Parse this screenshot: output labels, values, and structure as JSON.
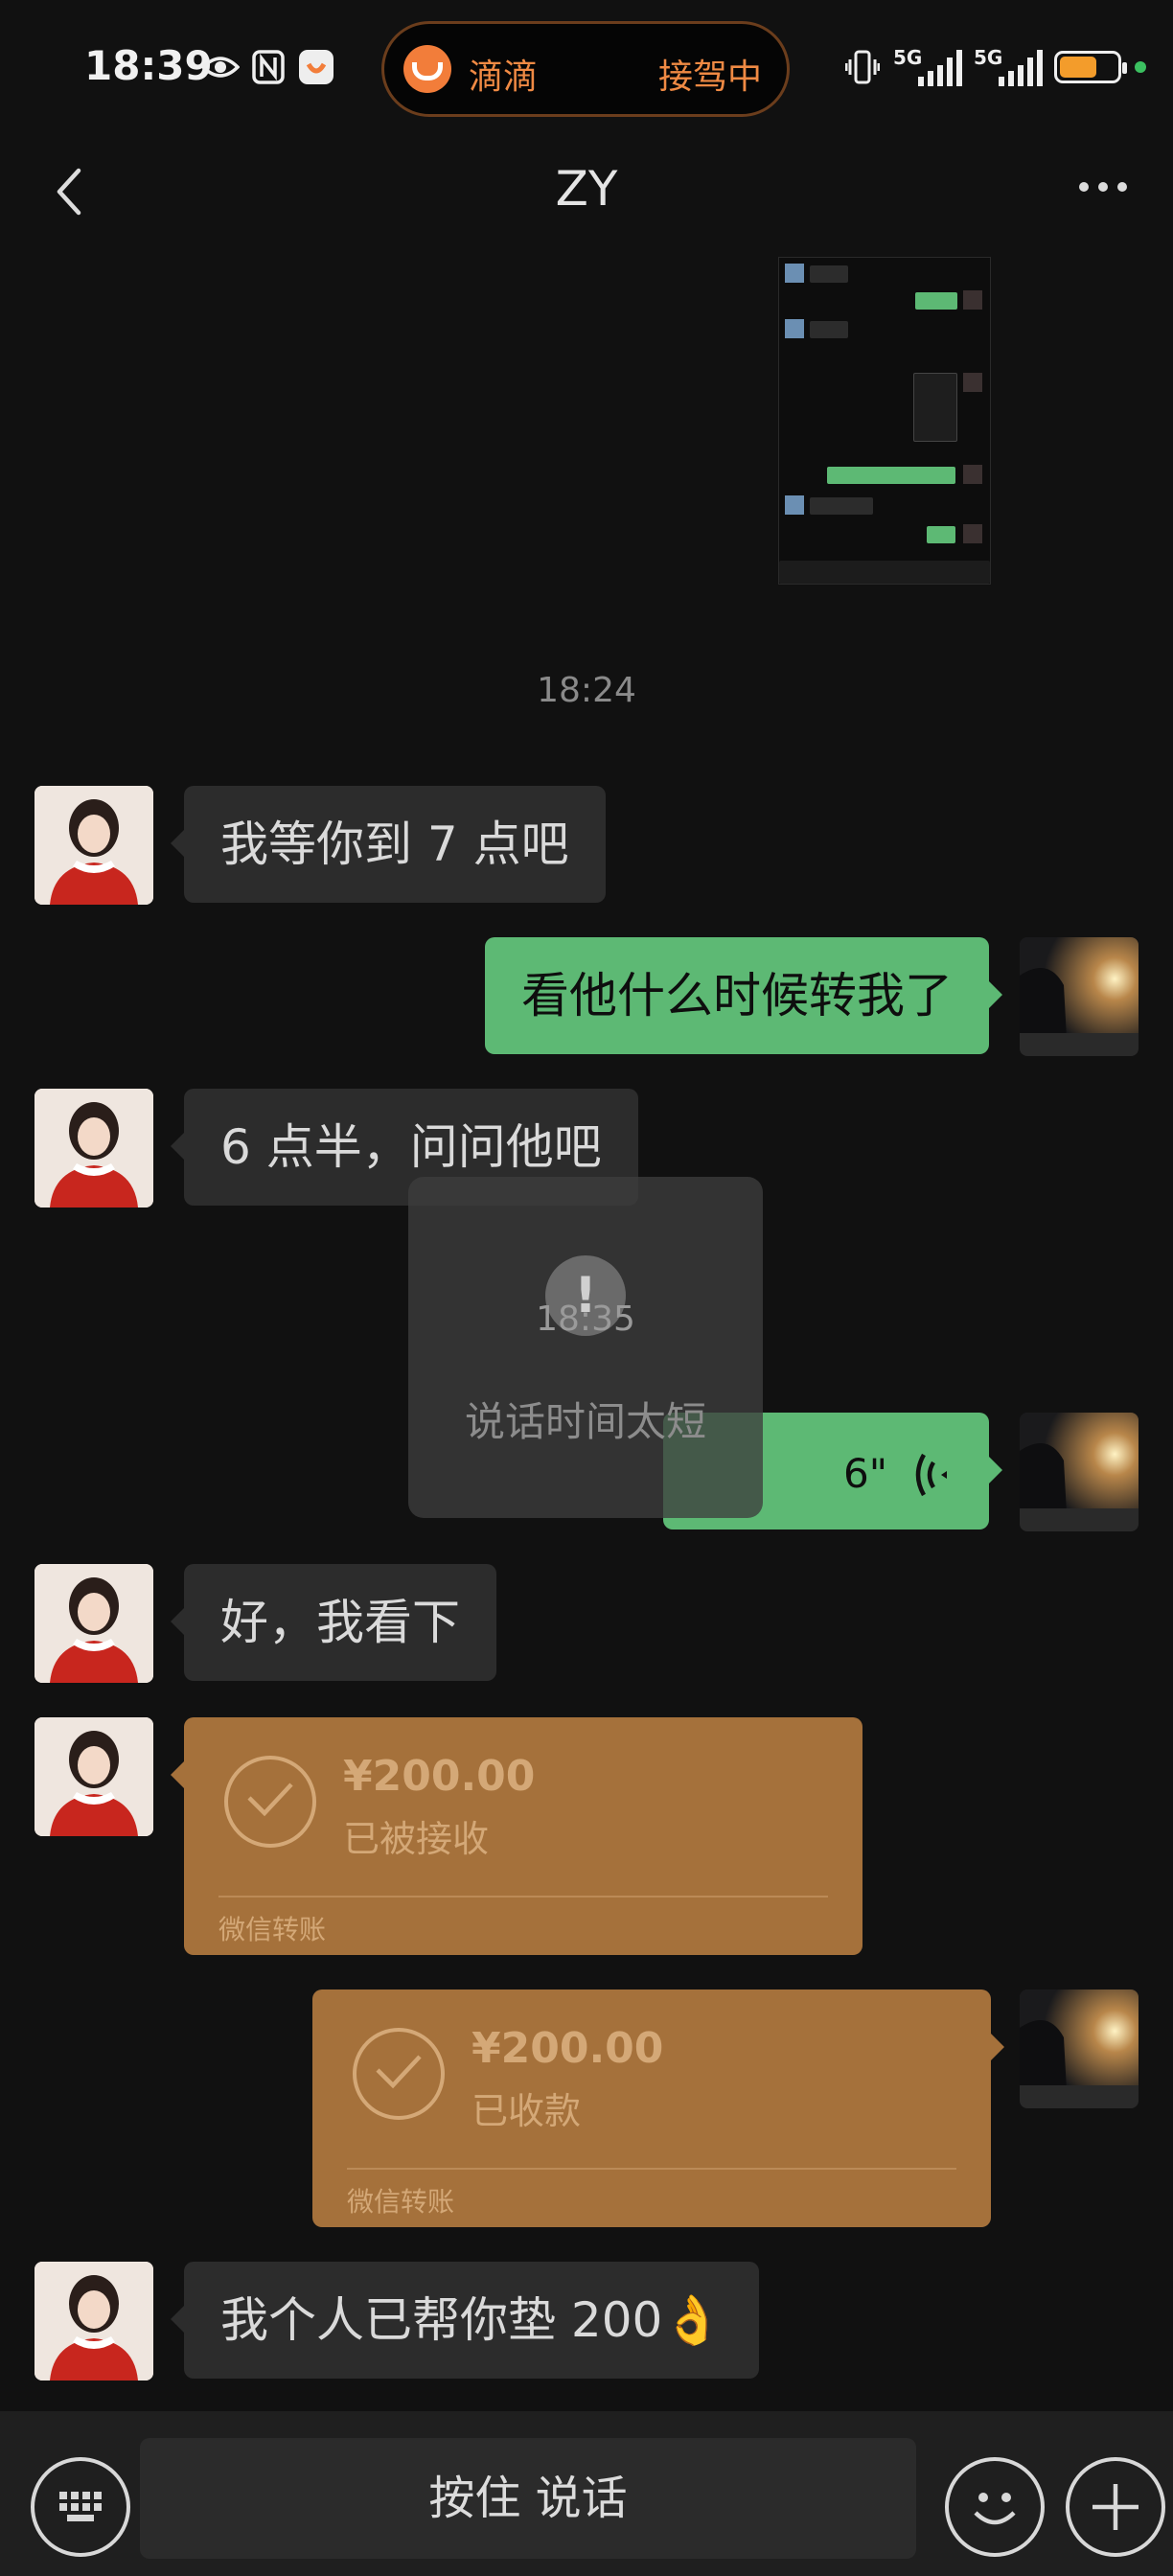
{
  "status_bar": {
    "time": "18:39",
    "left_icons": [
      "eye-icon",
      "nfc-icon",
      "didi-notification-icon"
    ],
    "live_activity": {
      "app": "滴滴",
      "status": "接驾中"
    },
    "network_1": "5G",
    "network_2": "5G",
    "battery_level": 0.65
  },
  "header": {
    "title": "ZY"
  },
  "shared_screenshot": {
    "rows": [
      "",
      "",
      "",
      "",
      "",
      "",
      "",
      ""
    ]
  },
  "timestamps": {
    "t1": "18:24",
    "t2": "18:35"
  },
  "messages": [
    {
      "from": "them",
      "text": "我等你到 7 点吧"
    },
    {
      "from": "me",
      "text": "看他什么时候转我了"
    },
    {
      "from": "them",
      "text": "6 点半，问问他吧"
    },
    {
      "from": "me",
      "voice_duration": "6\""
    },
    {
      "from": "them",
      "text": "好，我看下"
    },
    {
      "from": "them",
      "transfer": {
        "amount": "¥200.00",
        "status": "已被接收",
        "label": "微信转账"
      }
    },
    {
      "from": "me",
      "transfer": {
        "amount": "¥200.00",
        "status": "已收款",
        "label": "微信转账"
      }
    },
    {
      "from": "them",
      "text": "我个人已帮你垫 200👌"
    }
  ],
  "toast": {
    "text": "说话时间太短",
    "icon": "!"
  },
  "input_bar": {
    "hold_to_talk": "按住 说话"
  },
  "colors": {
    "outgoing_bubble": "#5db974",
    "incoming_bubble": "#2c2c2c",
    "transfer": "#a5713b",
    "didi_orange": "#f27d3a"
  }
}
